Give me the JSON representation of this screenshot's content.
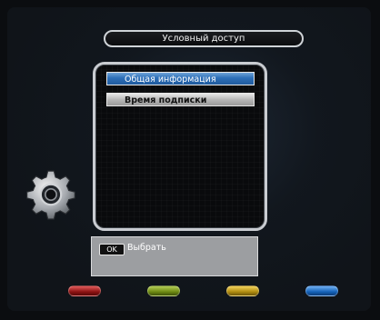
{
  "header": {
    "title": "Условный доступ"
  },
  "menu": {
    "items": [
      {
        "label": "Общая информация",
        "selected": true
      },
      {
        "label": "Время подписки",
        "selected": false
      }
    ]
  },
  "help": {
    "key": "OK",
    "label": "Выбрать"
  },
  "icons": {
    "settings": "gear-icon"
  },
  "colors": {
    "selection": "#2d6fb8",
    "help_bg": "#9c9ea1",
    "red_button": "#b52020",
    "green_button": "#8aa01e",
    "yellow_button": "#d2aa18",
    "blue_button": "#1f72c8"
  },
  "color_buttons": [
    "red",
    "green",
    "yellow",
    "blue"
  ]
}
